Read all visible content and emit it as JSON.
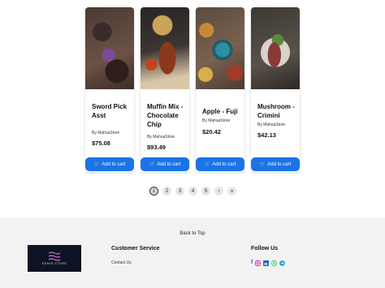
{
  "products": [
    {
      "name": "Sword Pick Asst",
      "store": "By MahsaStore",
      "price": "$75.08",
      "button": "Add to cart"
    },
    {
      "name": "Muffin Mix - Chocolate Chip",
      "store": "By MahsaStore",
      "price": "$93.49",
      "button": "Add to cart"
    },
    {
      "name": "Apple - Fuji",
      "store": "By MahsaStore",
      "price": "$20.42",
      "button": "Add to cart"
    },
    {
      "name": "Mushroom - Crimini",
      "store": "By MahsaStore",
      "price": "$42.13",
      "button": "Add to cart"
    }
  ],
  "pagination": {
    "pages": [
      "1",
      "2",
      "3",
      "4",
      "5"
    ],
    "active_page": "1",
    "next": "›",
    "last": "»"
  },
  "footer": {
    "back_to_top": "Back to Top",
    "logo_text": "DEMIR STORE",
    "customer_service_title": "Customer Service",
    "contact_us": "Contact Us",
    "follow_us_title": "Follow Us"
  },
  "icons": {
    "cart": "shopping-cart-icon",
    "social": [
      "facebook-icon",
      "instagram-icon",
      "linkedin-icon",
      "whatsapp-icon",
      "telegram-icon"
    ]
  },
  "colors": {
    "accent": "#1a73e8",
    "footer_bg": "#f2f2f2",
    "logo_bg": "#0d1322"
  }
}
